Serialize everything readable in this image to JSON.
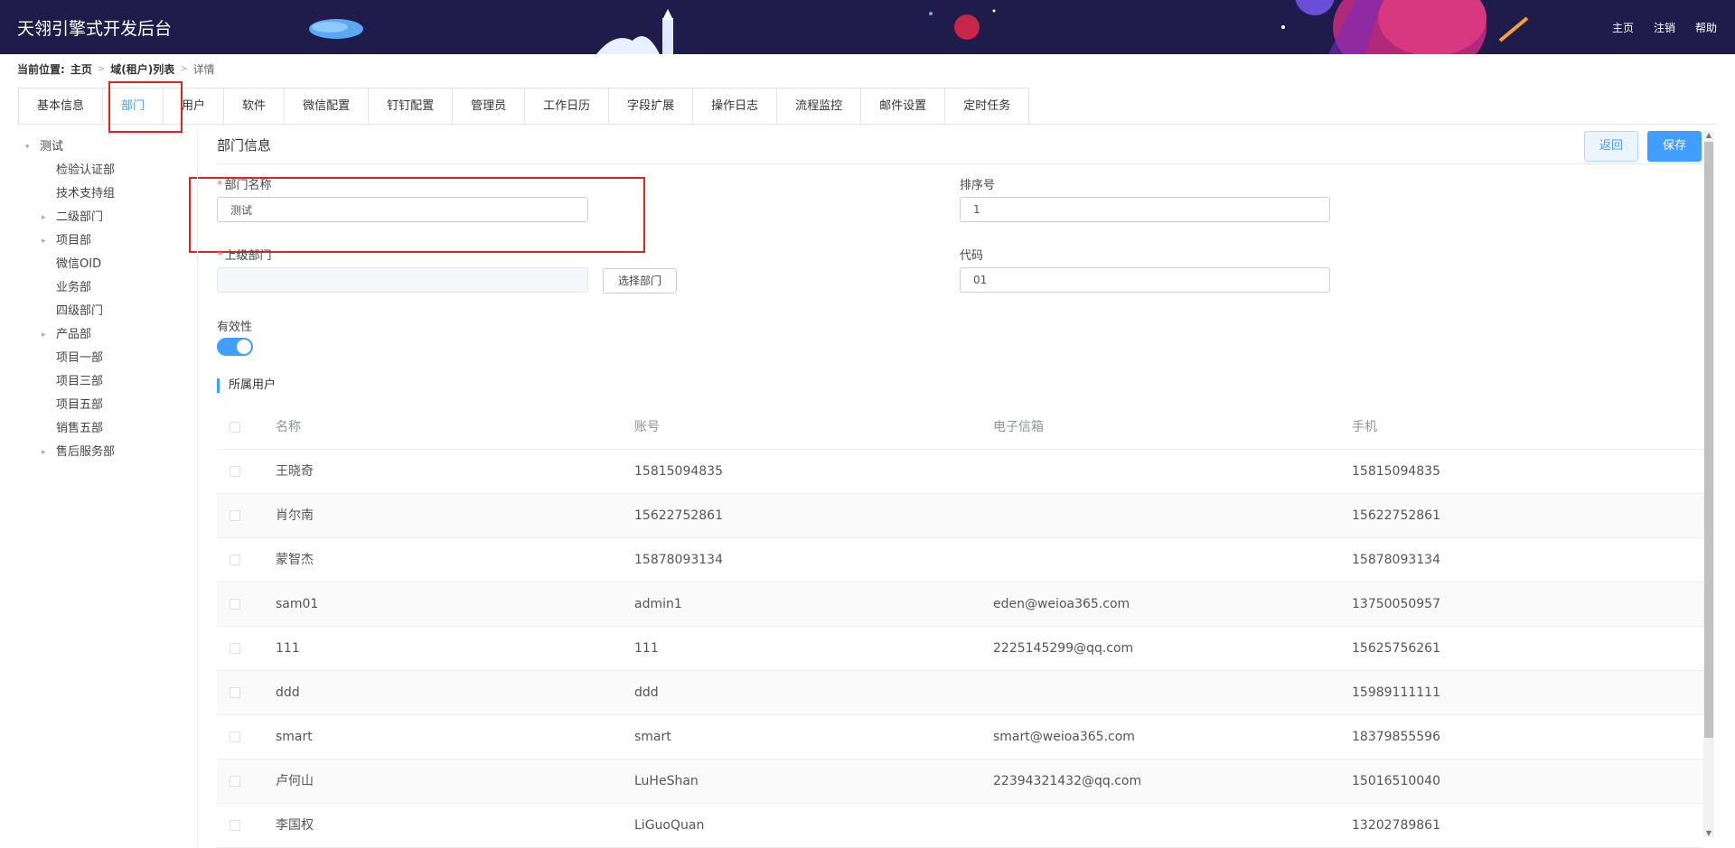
{
  "header": {
    "title": "天翎引擎式开发后台",
    "nav": [
      "主页",
      "注销",
      "帮助"
    ]
  },
  "breadcrumb": {
    "prefix": "当前位置:",
    "items": [
      "主页",
      "域(租户)列表",
      "详情"
    ]
  },
  "tabs": [
    {
      "label": "基本信息",
      "active": false
    },
    {
      "label": "部门",
      "active": true
    },
    {
      "label": "用户",
      "active": false
    },
    {
      "label": "软件",
      "active": false
    },
    {
      "label": "微信配置",
      "active": false
    },
    {
      "label": "钉钉配置",
      "active": false
    },
    {
      "label": "管理员",
      "active": false
    },
    {
      "label": "工作日历",
      "active": false
    },
    {
      "label": "字段扩展",
      "active": false
    },
    {
      "label": "操作日志",
      "active": false
    },
    {
      "label": "流程监控",
      "active": false
    },
    {
      "label": "邮件设置",
      "active": false
    },
    {
      "label": "定时任务",
      "active": false
    }
  ],
  "tree": {
    "root": "测试",
    "items": [
      {
        "label": "检验认证部",
        "expandable": false
      },
      {
        "label": "技术支持组",
        "expandable": false
      },
      {
        "label": "二级部门",
        "expandable": true
      },
      {
        "label": "项目部",
        "expandable": true
      },
      {
        "label": "微信OID",
        "expandable": false
      },
      {
        "label": "业务部",
        "expandable": false
      },
      {
        "label": "四级部门",
        "expandable": false
      },
      {
        "label": "产品部",
        "expandable": true
      },
      {
        "label": "项目一部",
        "expandable": false
      },
      {
        "label": "项目三部",
        "expandable": false
      },
      {
        "label": "项目五部",
        "expandable": false
      },
      {
        "label": "销售五部",
        "expandable": false
      },
      {
        "label": "售后服务部",
        "expandable": true
      }
    ]
  },
  "form": {
    "section_title": "部门信息",
    "back_label": "返回",
    "save_label": "保存",
    "name_label": "部门名称",
    "name_value": "测试",
    "sort_label": "排序号",
    "sort_value": "1",
    "parent_label": "上级部门",
    "parent_value": "",
    "select_dept_label": "选择部门",
    "code_label": "代码",
    "code_value": "01",
    "valid_label": "有效性",
    "valid_on": true
  },
  "users": {
    "title": "所属用户",
    "columns": [
      "名称",
      "账号",
      "电子信箱",
      "手机"
    ],
    "rows": [
      [
        "王晓奇",
        "15815094835",
        "",
        "15815094835"
      ],
      [
        "肖尔南",
        "15622752861",
        "",
        "15622752861"
      ],
      [
        "蒙智杰",
        "15878093134",
        "",
        "15878093134"
      ],
      [
        "sam01",
        "admin1",
        "eden@weioa365.com",
        "13750050957"
      ],
      [
        "111",
        "111",
        "2225145299@qq.com",
        "15625756261"
      ],
      [
        "ddd",
        "ddd",
        "",
        "15989111111"
      ],
      [
        "smart",
        "smart",
        "smart@weioa365.com",
        "18379855596"
      ],
      [
        "卢何山",
        "LuHeShan",
        "22394321432@qq.com",
        "15016510040"
      ],
      [
        "李国权",
        "LiGuoQuan",
        "",
        "13202789861"
      ]
    ]
  },
  "colors": {
    "header_bg": "#1f1c4b",
    "accent": "#409eff",
    "highlight": "#e52222"
  }
}
